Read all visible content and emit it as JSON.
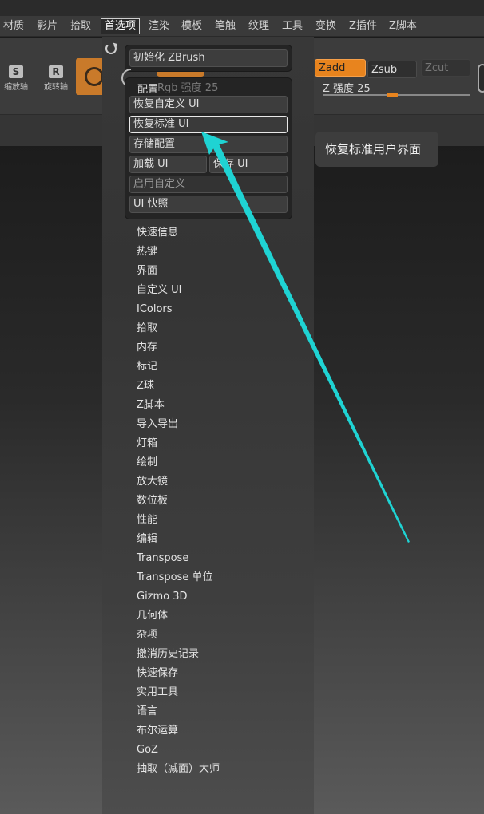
{
  "menubar": {
    "items": [
      "材质",
      "影片",
      "拾取",
      "首选项",
      "渲染",
      "模板",
      "笔触",
      "纹理",
      "工具",
      "变换",
      "Z插件",
      "Z脚本"
    ],
    "active_index": 3
  },
  "toolbar": {
    "tool1_glyph": "S",
    "tool1_label": "缩放轴",
    "tool2_glyph": "R",
    "tool2_label": "旋转轴",
    "zadd": "Zadd",
    "zsub": "Zsub",
    "zcut": "Zcut",
    "z_intensity": "Z 强度 25",
    "z_intensity_value": 25,
    "rgb_intensity": "Rgb 强度 25"
  },
  "preferences": {
    "init_button": "初始化 ZBrush",
    "config_title": "配置",
    "config_buttons": {
      "restore_custom": "恢复自定义 UI",
      "restore_standard": "恢复标准 UI",
      "store_config": "存储配置",
      "load_ui": "加载 UI",
      "save_ui": "保存 UI",
      "enable_custom": "启用自定义",
      "ui_snapshot": "UI 快照"
    },
    "subpalettes": [
      "快速信息",
      "热键",
      "界面",
      "自定义 UI",
      "IColors",
      "拾取",
      "内存",
      "标记",
      "Z球",
      "Z脚本",
      "导入导出",
      "灯箱",
      "绘制",
      "放大镜",
      "数位板",
      "性能",
      "编辑",
      "Transpose",
      "Transpose 单位",
      "Gizmo 3D",
      "几何体",
      "杂项",
      "撤消历史记录",
      "快速保存",
      "实用工具",
      "语言",
      "布尔运算",
      "GoZ",
      "抽取（减面）大师"
    ]
  },
  "tooltip": "恢复标准用户界面",
  "colors": {
    "accent_orange": "#e8841e",
    "annotation_arrow": "#1fd3d3"
  }
}
